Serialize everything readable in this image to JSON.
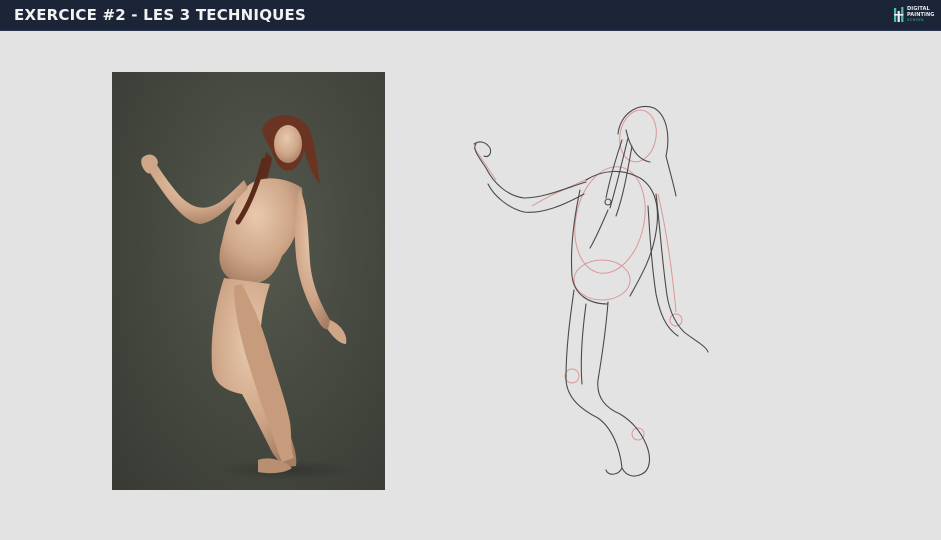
{
  "header": {
    "title": "EXERCICE #2 - LES 3 TECHNIQUES",
    "logo": {
      "line1": "DIGITAL",
      "line2": "PAINTING",
      "line3": "SCHOOL",
      "icon": "dps-logo-icon"
    }
  },
  "colors": {
    "header_bg": "#1b2537",
    "page_bg": "#e3e3e3",
    "photo_bg": "#474a41",
    "sketch_line": "#3a3a3a",
    "construction_line": "#d98a8a",
    "logo_accent": "#4fbfaa"
  },
  "main": {
    "reference_photo": {
      "kind": "reference-figure-photo"
    },
    "sketch": {
      "kind": "gesture-sketch-drawing"
    }
  }
}
